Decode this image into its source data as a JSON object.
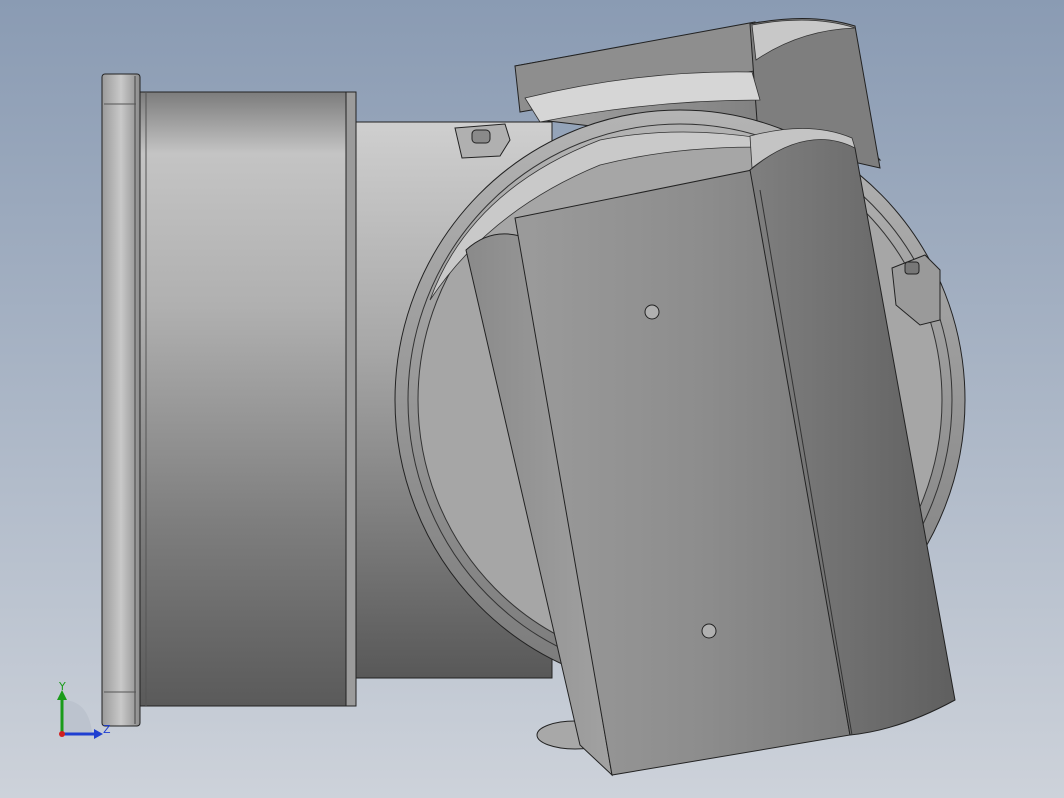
{
  "viewport": {
    "background_top": "#8a9bb3",
    "background_bottom": "#cdd2da"
  },
  "triad": {
    "y_label": "Y",
    "z_label": "Z",
    "y_color": "#1a9b1a",
    "z_color": "#1f3fd1",
    "x_color": "#d11f1f"
  }
}
